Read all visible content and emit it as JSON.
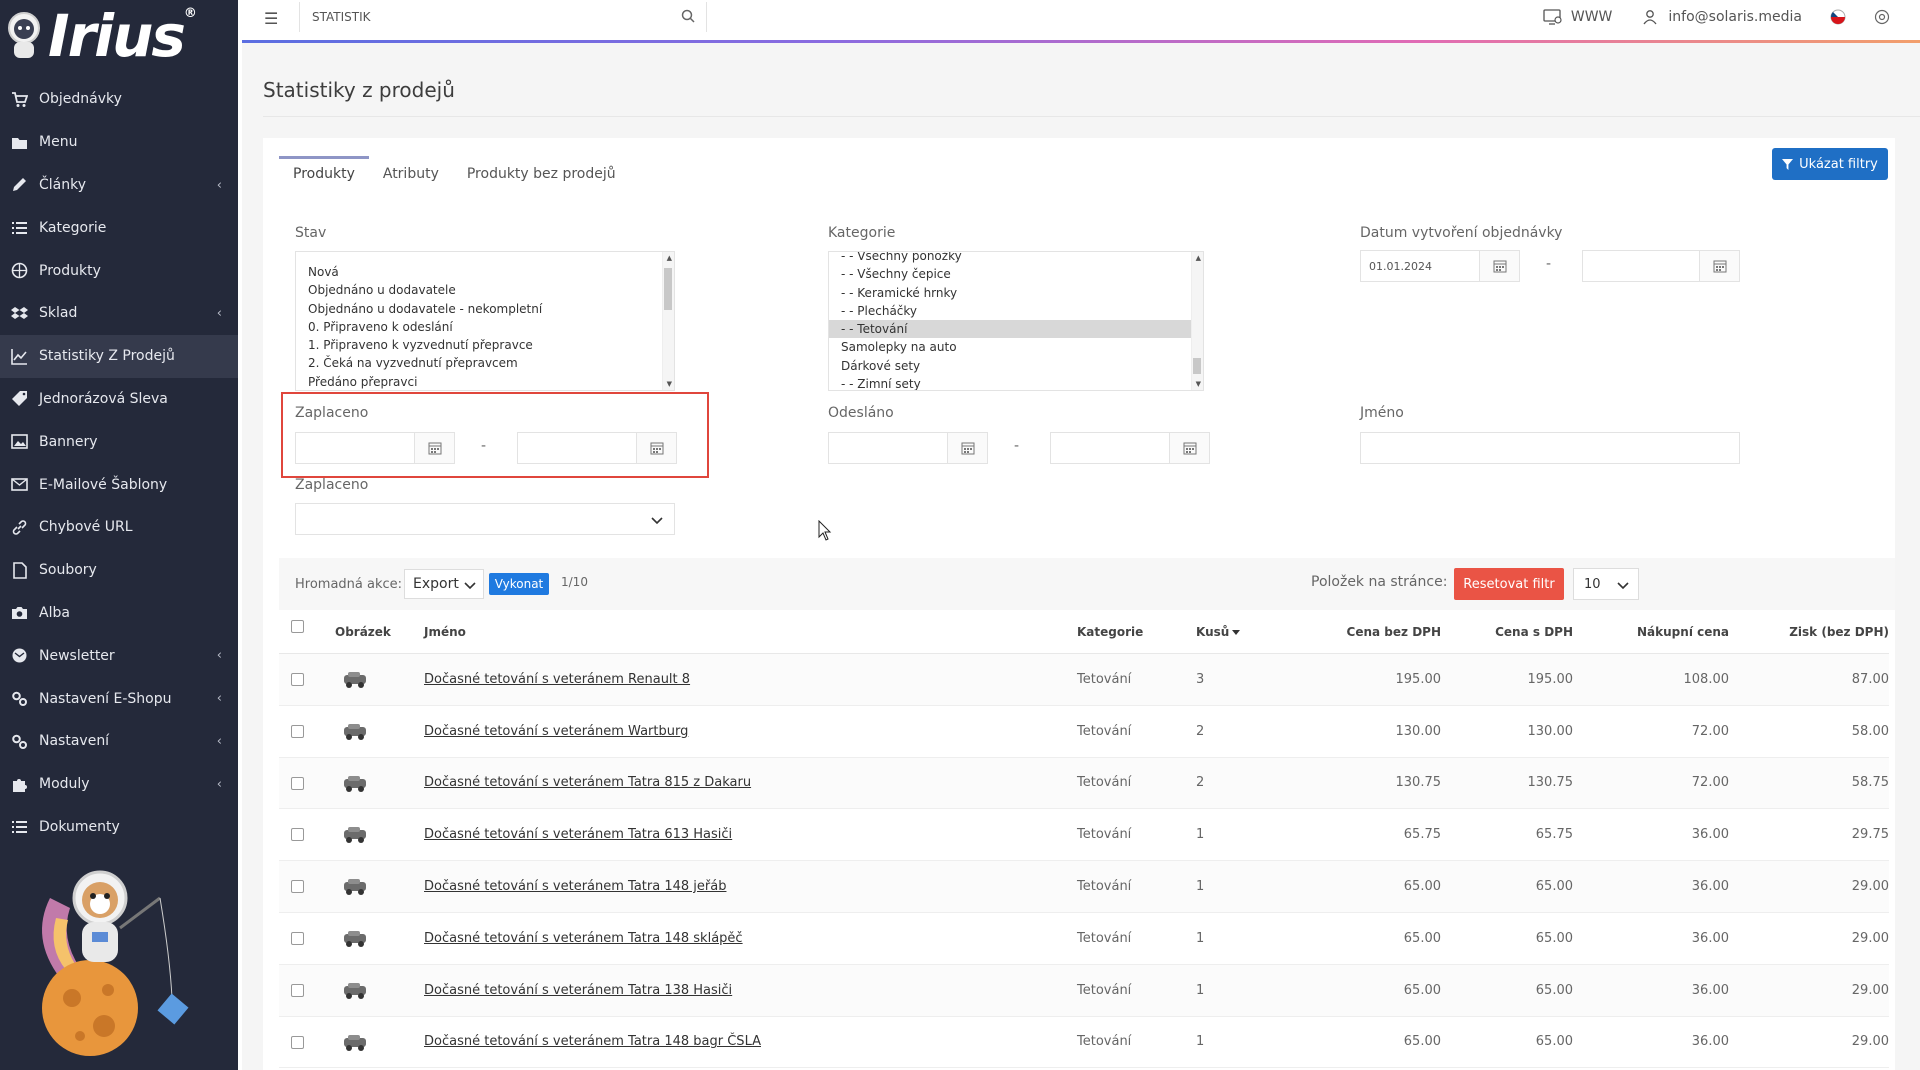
{
  "app": {
    "logo_text": "Irius",
    "logo_mark": "®"
  },
  "sidebar": {
    "items": [
      {
        "label": "Objednávky",
        "icon": "cart-icon",
        "chevron": false,
        "active": false
      },
      {
        "label": "Menu",
        "icon": "folder-icon",
        "chevron": false,
        "active": false
      },
      {
        "label": "Články",
        "icon": "pencil-icon",
        "chevron": true,
        "active": false
      },
      {
        "label": "Kategorie",
        "icon": "list-icon",
        "chevron": false,
        "active": false
      },
      {
        "label": "Produkty",
        "icon": "basketball-icon",
        "chevron": false,
        "active": false
      },
      {
        "label": "Sklad",
        "icon": "dropbox-icon",
        "chevron": true,
        "active": false
      },
      {
        "label": "Statistiky Z Prodejů",
        "icon": "line-chart-icon",
        "chevron": false,
        "active": true
      },
      {
        "label": "Jednorázová Sleva",
        "icon": "tag-icon",
        "chevron": false,
        "active": false
      },
      {
        "label": "Bannery",
        "icon": "image-icon",
        "chevron": false,
        "active": false
      },
      {
        "label": "E-Mailové Šablony",
        "icon": "envelope-icon",
        "chevron": false,
        "active": false
      },
      {
        "label": "Chybové URL",
        "icon": "link-icon",
        "chevron": false,
        "active": false
      },
      {
        "label": "Soubory",
        "icon": "file-icon",
        "chevron": false,
        "active": false
      },
      {
        "label": "Alba",
        "icon": "camera-icon",
        "chevron": false,
        "active": false
      },
      {
        "label": "Newsletter",
        "icon": "newsletter-icon",
        "chevron": true,
        "active": false
      },
      {
        "label": "Nastavení E-Shopu",
        "icon": "cogs-icon",
        "chevron": true,
        "active": false
      },
      {
        "label": "Nastavení",
        "icon": "cogs-icon",
        "chevron": true,
        "active": false
      },
      {
        "label": "Moduly",
        "icon": "puzzle-icon",
        "chevron": true,
        "active": false
      },
      {
        "label": "Dokumenty",
        "icon": "list-icon",
        "chevron": false,
        "active": false
      }
    ]
  },
  "topbar": {
    "search_value": "STATISTIK",
    "www_label": "WWW",
    "user_email": "info@solaris.media"
  },
  "page": {
    "title": "Statistiky z prodejů"
  },
  "tabs": [
    {
      "label": "Produkty",
      "active": true
    },
    {
      "label": "Atributy",
      "active": false
    },
    {
      "label": "Produkty bez prodejů",
      "active": false
    }
  ],
  "filters": {
    "show_filters_label": "Ukázat filtry",
    "stav_label": "Stav",
    "stav_options": [
      "Nová",
      "Objednáno u dodavatele",
      "Objednáno u dodavatele - nekompletní",
      "0. Připraveno k odeslání",
      "1. Připraveno k vyzvednutí přepravce",
      "2. Čeká na vyzvednutí přepravcem",
      "Předáno přepravci"
    ],
    "kategorie_label": "Kategorie",
    "kategorie_options": [
      {
        "label": "- - Všechny ponožky",
        "selected": false
      },
      {
        "label": "- - Všechny čepice",
        "selected": false
      },
      {
        "label": "- - Keramické hrnky",
        "selected": false
      },
      {
        "label": "- - Plecháčky",
        "selected": false
      },
      {
        "label": "- - Tetování",
        "selected": true
      },
      {
        "label": "Samolepky na auto",
        "selected": false
      },
      {
        "label": "Dárkové sety",
        "selected": false
      },
      {
        "label": "- - Zimní sety",
        "selected": false
      }
    ],
    "datum_label": "Datum vytvoření objednávky",
    "datum_from": "01.01.2024",
    "datum_to": "",
    "zaplaceno_label": "Zaplaceno",
    "zaplaceno_from": "",
    "zaplaceno_to": "",
    "odeslano_label": "Odesláno",
    "odeslano_from": "",
    "odeslano_to": "",
    "jmeno_label": "Jméno",
    "jmeno_value": "",
    "zaplaceno_select_label": "Zaplaceno",
    "zaplaceno_select_value": "",
    "range_dash": "-"
  },
  "bulk": {
    "label": "Hromadná akce:",
    "export_value": "Export",
    "run_label": "Vykonat",
    "page_count": "1/10",
    "per_page_label": "Položek na stránce:",
    "reset_label": "Resetovat filtr",
    "per_page_value": "10"
  },
  "table": {
    "headers": {
      "image": "Obrázek",
      "name": "Jméno",
      "category": "Kategorie",
      "qty": "Kusů",
      "price_no_vat": "Cena bez DPH",
      "price_vat": "Cena s DPH",
      "buy_price": "Nákupní cena",
      "profit": "Zisk (bez DPH)"
    },
    "rows": [
      {
        "name": "Dočasné tetování s veteránem Renault 8",
        "category": "Tetování",
        "qty": "3",
        "price_no_vat": "195.00",
        "price_vat": "195.00",
        "buy_price": "108.00",
        "profit": "87.00"
      },
      {
        "name": "Dočasné tetování s veteránem Wartburg",
        "category": "Tetování",
        "qty": "2",
        "price_no_vat": "130.00",
        "price_vat": "130.00",
        "buy_price": "72.00",
        "profit": "58.00"
      },
      {
        "name": "Dočasné tetování s veteránem Tatra 815 z Dakaru",
        "category": "Tetování",
        "qty": "2",
        "price_no_vat": "130.75",
        "price_vat": "130.75",
        "buy_price": "72.00",
        "profit": "58.75"
      },
      {
        "name": "Dočasné tetování s veteránem Tatra 613 Hasiči",
        "category": "Tetování",
        "qty": "1",
        "price_no_vat": "65.75",
        "price_vat": "65.75",
        "buy_price": "36.00",
        "profit": "29.75"
      },
      {
        "name": "Dočasné tetování s veteránem Tatra 148 jeřáb",
        "category": "Tetování",
        "qty": "1",
        "price_no_vat": "65.00",
        "price_vat": "65.00",
        "buy_price": "36.00",
        "profit": "29.00"
      },
      {
        "name": "Dočasné tetování s veteránem Tatra 148 sklápěč",
        "category": "Tetování",
        "qty": "1",
        "price_no_vat": "65.00",
        "price_vat": "65.00",
        "buy_price": "36.00",
        "profit": "29.00"
      },
      {
        "name": "Dočasné tetování s veteránem Tatra 138 Hasiči",
        "category": "Tetování",
        "qty": "1",
        "price_no_vat": "65.00",
        "price_vat": "65.00",
        "buy_price": "36.00",
        "profit": "29.00"
      },
      {
        "name": "Dočasné tetování s veteránem Tatra 148 bagr ČSLA",
        "category": "Tetování",
        "qty": "1",
        "price_no_vat": "65.00",
        "price_vat": "65.00",
        "buy_price": "36.00",
        "profit": "29.00"
      }
    ]
  },
  "colors": {
    "sidebar_bg": "#24293a",
    "primary_button": "#1f6fc5",
    "reset_button": "#ea5445",
    "highlight_border": "#e0463c"
  }
}
